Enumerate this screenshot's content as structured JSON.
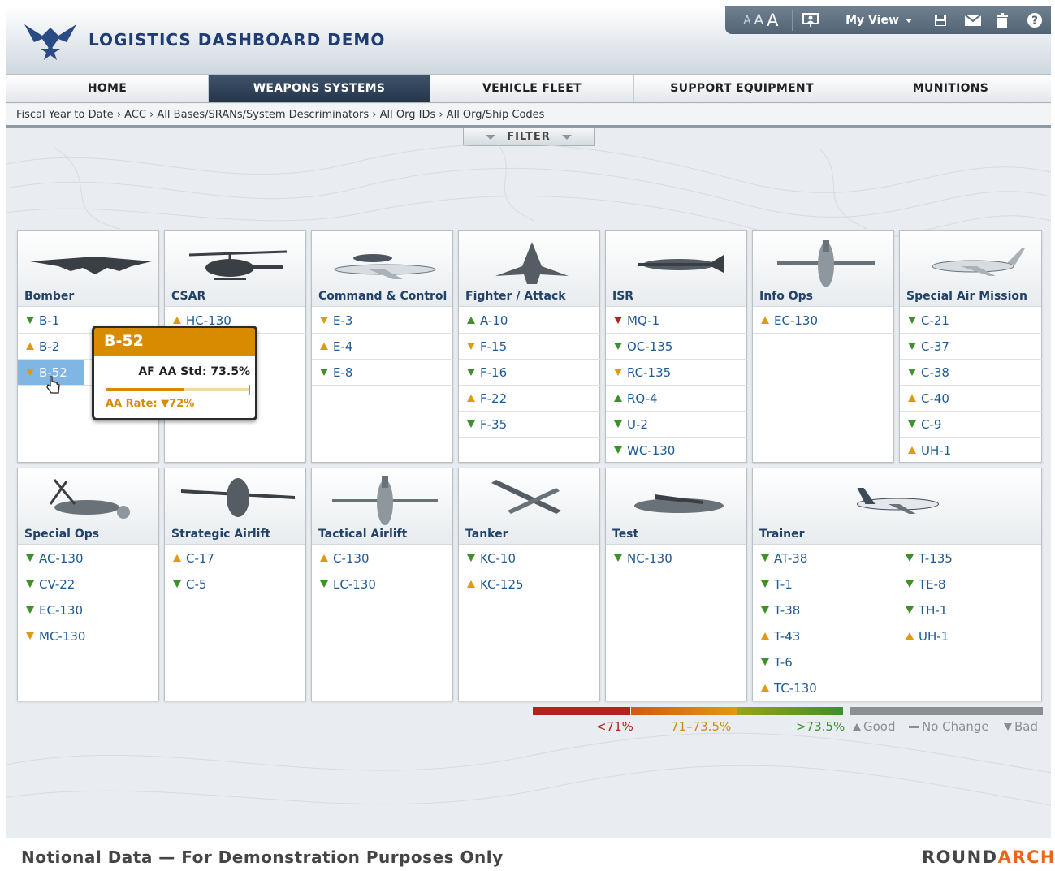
{
  "app": {
    "title": "LOGISTICS DASHBOARD DEMO",
    "logo": "air-force-logo"
  },
  "util": {
    "font_small": "A",
    "font_medium": "A",
    "font_large": "A",
    "my_view_label": "My View",
    "icons": [
      "presentation-icon",
      "save-icon",
      "mail-icon",
      "trash-icon",
      "help-icon"
    ]
  },
  "nav": {
    "tabs": [
      {
        "label": "HOME"
      },
      {
        "label": "WEAPONS SYSTEMS",
        "active": true
      },
      {
        "label": "VEHICLE FLEET"
      },
      {
        "label": "SUPPORT EQUIPMENT"
      },
      {
        "label": "MUNITIONS"
      }
    ]
  },
  "breadcrumb": "Fiscal Year to Date › ACC › All Bases/SRANs/System Descriminators › All Org IDs › All Org/Ship Codes",
  "filter_label": "FILTER",
  "groups": [
    {
      "title": "Bomber",
      "icon": "bomber-aircraft-image",
      "items": [
        {
          "name": "B-1",
          "trend": "down"
        },
        {
          "name": "B-2",
          "trend": "up"
        },
        {
          "name": "B-52",
          "trend": "down-warn",
          "selected": true
        }
      ]
    },
    {
      "title": "CSAR",
      "icon": "helicopter-image",
      "items": [
        {
          "name": "HC-130",
          "trend": "up"
        }
      ]
    },
    {
      "title": "Command & Control",
      "icon": "awacs-aircraft-image",
      "items": [
        {
          "name": "E-3",
          "trend": "down-warn"
        },
        {
          "name": "E-4",
          "trend": "up"
        },
        {
          "name": "E-8",
          "trend": "down"
        }
      ]
    },
    {
      "title": "Fighter / Attack",
      "icon": "fighter-jet-image",
      "items": [
        {
          "name": "A-10",
          "trend": "up-good"
        },
        {
          "name": "F-15",
          "trend": "down-warn"
        },
        {
          "name": "F-16",
          "trend": "down"
        },
        {
          "name": "F-22",
          "trend": "up"
        },
        {
          "name": "F-35",
          "trend": "down"
        }
      ]
    },
    {
      "title": "ISR",
      "icon": "drone-image",
      "items": [
        {
          "name": "MQ-1",
          "trend": "down-bad"
        },
        {
          "name": "OC-135",
          "trend": "down"
        },
        {
          "name": "RC-135",
          "trend": "down-warn"
        },
        {
          "name": "RQ-4",
          "trend": "up-good"
        },
        {
          "name": "U-2",
          "trend": "down"
        },
        {
          "name": "WC-130",
          "trend": "down"
        }
      ]
    },
    {
      "title": "Info Ops",
      "icon": "cargo-aircraft-image",
      "items": [
        {
          "name": "EC-130",
          "trend": "up"
        }
      ]
    },
    {
      "title": "Special Air Mission",
      "icon": "business-jet-image",
      "items": [
        {
          "name": "C-21",
          "trend": "down"
        },
        {
          "name": "C-37",
          "trend": "down"
        },
        {
          "name": "C-38",
          "trend": "down"
        },
        {
          "name": "C-40",
          "trend": "up"
        },
        {
          "name": "C-9",
          "trend": "down"
        },
        {
          "name": "UH-1",
          "trend": "up"
        }
      ]
    },
    {
      "title": "Special Ops",
      "icon": "tiltrotor-image",
      "items": [
        {
          "name": "AC-130",
          "trend": "down"
        },
        {
          "name": "CV-22",
          "trend": "down"
        },
        {
          "name": "EC-130",
          "trend": "down"
        },
        {
          "name": "MC-130",
          "trend": "down-warn"
        }
      ]
    },
    {
      "title": "Strategic Airlift",
      "icon": "heavy-transport-image",
      "items": [
        {
          "name": "C-17",
          "trend": "up"
        },
        {
          "name": "C-5",
          "trend": "down"
        }
      ]
    },
    {
      "title": "Tactical Airlift",
      "icon": "tactical-airlifter-image",
      "items": [
        {
          "name": "C-130",
          "trend": "up"
        },
        {
          "name": "LC-130",
          "trend": "down"
        }
      ]
    },
    {
      "title": "Tanker",
      "icon": "tanker-aircraft-image",
      "items": [
        {
          "name": "KC-10",
          "trend": "down"
        },
        {
          "name": "KC-125",
          "trend": "up"
        }
      ]
    },
    {
      "title": "Test",
      "icon": "test-aircraft-image",
      "items": [
        {
          "name": "NC-130",
          "trend": "down"
        }
      ]
    },
    {
      "title": "Trainer",
      "icon": "trainer-jet-image",
      "items": [
        {
          "name": "AT-38",
          "trend": "down"
        },
        {
          "name": "T-1",
          "trend": "down"
        },
        {
          "name": "T-38",
          "trend": "down"
        },
        {
          "name": "T-43",
          "trend": "up"
        },
        {
          "name": "T-6",
          "trend": "down"
        },
        {
          "name": "TC-130",
          "trend": "up"
        },
        {
          "name": "T-135",
          "trend": "down"
        },
        {
          "name": "TE-8",
          "trend": "down"
        },
        {
          "name": "TH-1",
          "trend": "down"
        },
        {
          "name": "UH-1",
          "trend": "up"
        }
      ]
    }
  ],
  "tooltip": {
    "title": "B-52",
    "std_label": "AF AA Std: 73.5%",
    "rate_label": "AA Rate: ▼72%",
    "rate_value": 72,
    "std_value": 73.5
  },
  "legend": {
    "low": "<71%",
    "mid": "71–73.5%",
    "high": ">73.5%",
    "good": "Good",
    "no_change": "No Change",
    "bad": "Bad",
    "colors": {
      "low": "#b3221b",
      "mid": "#e09a10",
      "high": "#3f8f2a",
      "neutral": "#8c8f92"
    }
  },
  "footer": {
    "notice": "Notional Data — For Demonstration Purposes Only",
    "brand_a": "ROUND",
    "brand_b": "ARCH"
  }
}
